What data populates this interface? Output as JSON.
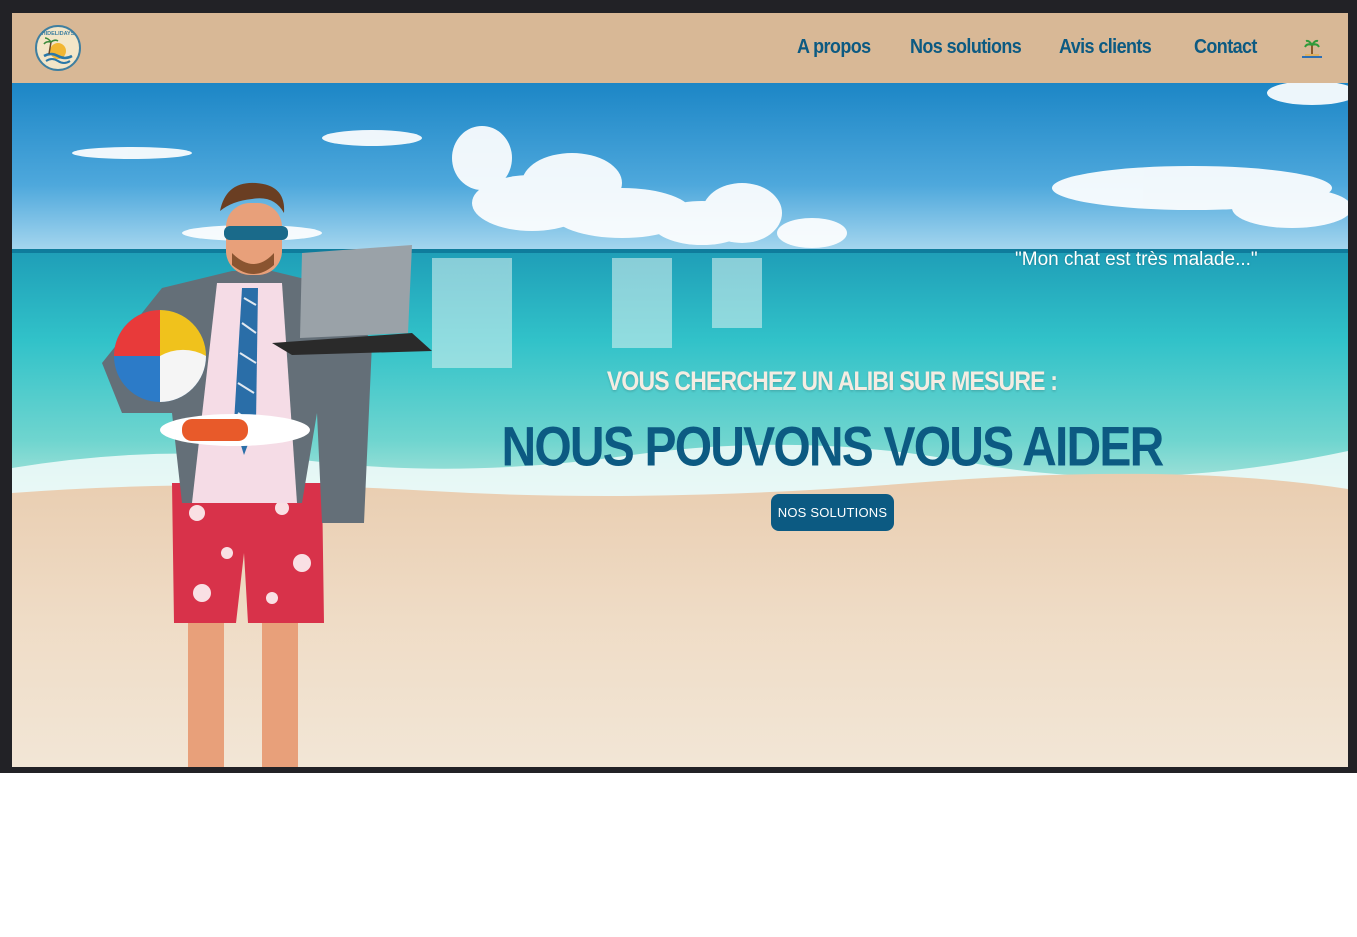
{
  "navbar": {
    "logo_text": "HIDELIDAYS",
    "links": [
      "A propos",
      "Nos solutions",
      "Avis clients",
      "Contact"
    ],
    "icon": "palm-tree-icon",
    "background_color": "#d8b896",
    "link_color": "#0c5a82"
  },
  "hero": {
    "quote": "\"Mon chat est très malade...\"",
    "subtitle": "VOUS CHERCHEZ UN ALIBI SUR MESURE :",
    "headline": "NOUS POUVONS VOUS AIDER",
    "cta_label": "NOS SOLUTIONS",
    "accent_color": "#0c5a82"
  }
}
